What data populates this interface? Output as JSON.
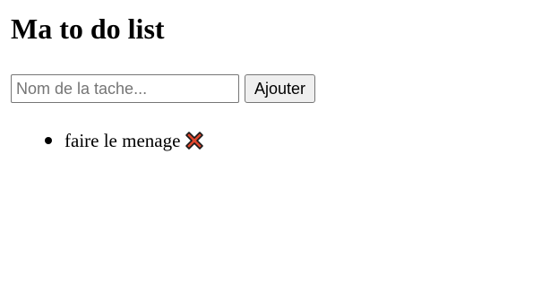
{
  "header": {
    "title": "Ma to do list"
  },
  "form": {
    "input_placeholder": "Nom de la tache...",
    "input_value": "",
    "add_label": "Ajouter"
  },
  "tasks": [
    {
      "label": "faire le menage",
      "delete_icon": "cross-mark-icon"
    }
  ],
  "colors": {
    "delete_fill": "#e0462c",
    "delete_stroke": "#1a1a1a"
  }
}
